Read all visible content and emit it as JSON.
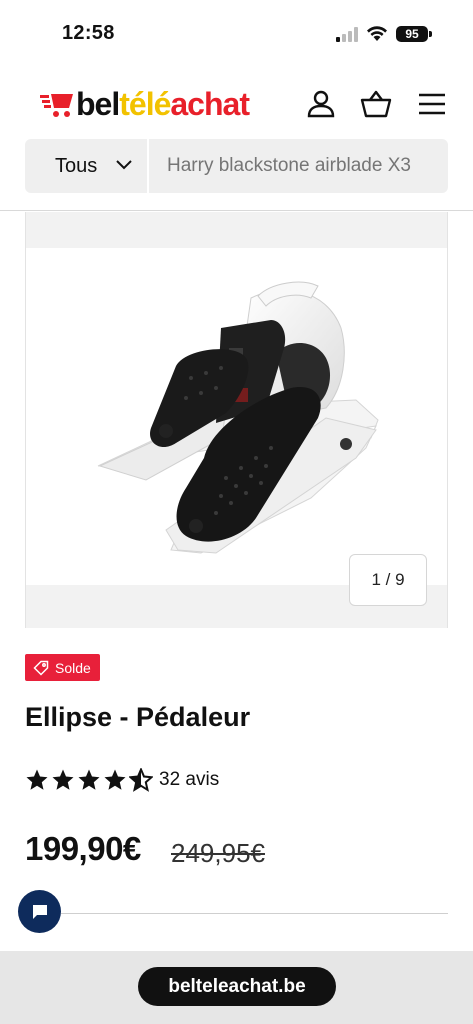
{
  "status_bar": {
    "time": "12:58",
    "battery": "95"
  },
  "header": {
    "logo": {
      "part1": "bel",
      "part2": "télé",
      "part3": "achat",
      "colors": {
        "dark": "#111111",
        "yellow": "#f2c200",
        "red": "#e8202a"
      }
    },
    "icons": [
      "account-icon",
      "basket-icon",
      "menu-icon"
    ]
  },
  "search": {
    "category": "Tous",
    "placeholder": "Harry blackstone airblade X3"
  },
  "gallery": {
    "counter": "1 / 9",
    "image_alt": "ellipse-pedaleur-product-image"
  },
  "product": {
    "badge": "Solde",
    "title": "Ellipse - Pédaleur",
    "rating": 4.5,
    "rating_max": 5,
    "reviews": "32 avis",
    "price": "199,90€",
    "old_price": "249,95€"
  },
  "browser": {
    "url": "belteleachat.be"
  },
  "colors": {
    "sale_badge": "#e8203a",
    "chat_button": "#0e2b5c"
  }
}
